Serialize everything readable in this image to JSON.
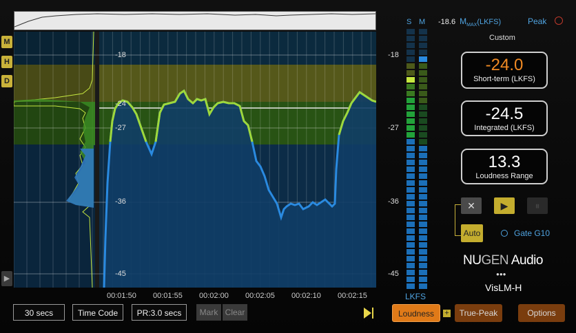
{
  "top_readout": {
    "value": "-18.6",
    "m": "M",
    "max": "MAX",
    "unit": "(LKFS)",
    "peak": "Peak"
  },
  "side_tabs": [
    "M",
    "H",
    "D"
  ],
  "meters": {
    "s_label": "S",
    "m_label": "M",
    "unit": "LKFS",
    "scale": [
      "-18",
      "-27",
      "-36",
      "-45"
    ]
  },
  "plot": {
    "y_labels": [
      "-18",
      "-24",
      "-27",
      "-36",
      "-45"
    ],
    "x_labels": [
      "00:01:50",
      "00:01:55",
      "00:02:00",
      "00:02:05",
      "00:02:10",
      "00:02:15"
    ],
    "target_line": -24,
    "colors": {
      "upper_band": "#5a5c1c",
      "target_band": "#2d5a16",
      "low_band": "#0f3350",
      "curve_high": "#c6e840",
      "curve_mid": "#2ea829",
      "curve_low": "#1f7fcf"
    }
  },
  "controls": {
    "time_window": "30 secs",
    "time_code": "Time Code",
    "pr": "PR:3.0 secs",
    "mark": "Mark",
    "clear": "Clear"
  },
  "preset": "Custom",
  "readouts": {
    "short_term": {
      "value": "-24.0",
      "label": "Short-term (LKFS)"
    },
    "integrated": {
      "value": "-24.5",
      "label": "Integrated (LKFS)"
    },
    "lra": {
      "value": "13.3",
      "label": "Loudness Range"
    }
  },
  "transport": {
    "stop": "✕",
    "play": "▶",
    "pause": "⏸",
    "auto": "Auto",
    "gate": "Gate G10"
  },
  "brand": {
    "nu": "NU",
    "gen": "GEN",
    "audio": " Audio",
    "dots": "●●●",
    "product": "VisLM-H"
  },
  "bottom_buttons": {
    "loudness": "Loudness",
    "plus": "+",
    "true_peak": "True-Peak",
    "options": "Options"
  }
}
